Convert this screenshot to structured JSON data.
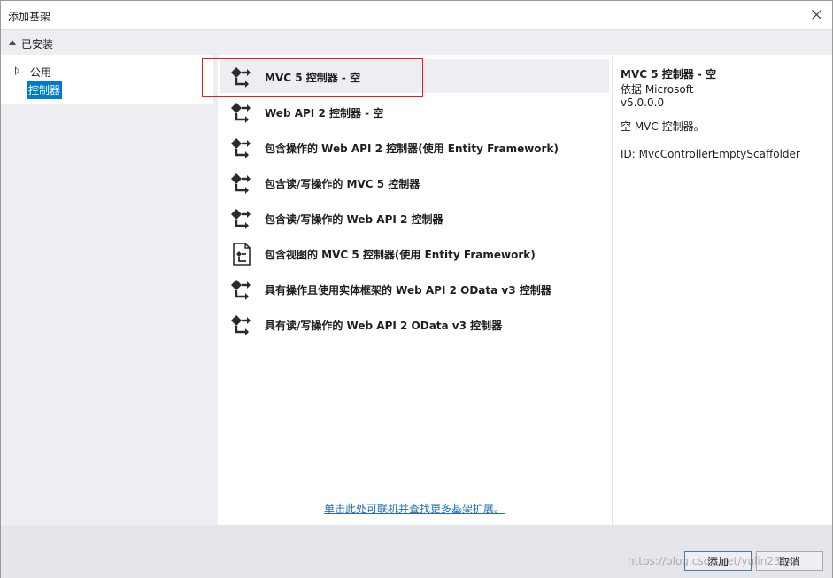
{
  "window": {
    "title": "添加基架"
  },
  "installed": {
    "label": "已安装"
  },
  "tree": {
    "items": [
      {
        "label": "公用"
      },
      {
        "label": "控制器"
      }
    ]
  },
  "templates": [
    {
      "label": "MVC 5 控制器 - 空",
      "icon": "controller-icon"
    },
    {
      "label": "Web API 2 控制器 - 空",
      "icon": "controller-icon"
    },
    {
      "label": "包含操作的 Web API 2 控制器(使用 Entity Framework)",
      "icon": "controller-icon"
    },
    {
      "label": "包含读/写操作的 MVC 5 控制器",
      "icon": "controller-icon"
    },
    {
      "label": "包含读/写操作的 Web API 2 控制器",
      "icon": "controller-icon"
    },
    {
      "label": "包含视图的 MVC 5 控制器(使用 Entity Framework)",
      "icon": "view-document-icon"
    },
    {
      "label": "具有操作且使用实体框架的 Web API 2 OData v3 控制器",
      "icon": "controller-icon"
    },
    {
      "label": "具有读/写操作的 Web API 2 OData v3 控制器",
      "icon": "controller-icon"
    }
  ],
  "online_link": "单击此处可联机并查找更多基架扩展。",
  "details": {
    "name": "MVC 5 控制器 - 空",
    "by": "依据 Microsoft",
    "version": "v5.0.0.0",
    "description": "空 MVC 控制器。",
    "id": "ID: MvcControllerEmptyScaffolder"
  },
  "buttons": {
    "add": "添加",
    "cancel": "取消"
  },
  "watermark": "https://blog.csdn.net/yulin2314",
  "colors": {
    "accent": "#007acc",
    "highlight_box": "#e02020",
    "link": "#1e6fb8"
  }
}
